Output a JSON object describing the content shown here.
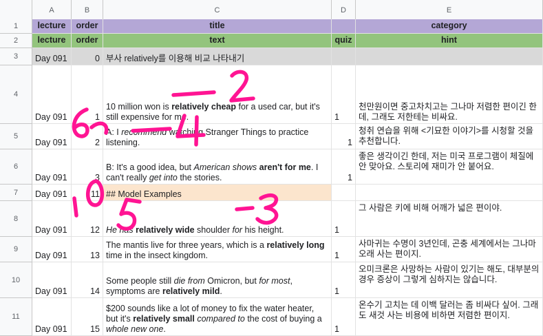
{
  "columns": [
    "A",
    "B",
    "C",
    "D",
    "E"
  ],
  "header_row_1": {
    "num": "1",
    "lecture": "lecture",
    "order": "order",
    "title": "title",
    "category": "category"
  },
  "header_row_2": {
    "num": "2",
    "lecture": "lecture",
    "order": "order",
    "text": "text",
    "quiz": "quiz",
    "hint": "hint"
  },
  "rows": [
    {
      "num": "3",
      "lecture": "Day 091",
      "order": "0",
      "text_html": "부사 relatively를 이용해 비교 나타내기",
      "quiz": "",
      "hint": ""
    },
    {
      "num": "4",
      "lecture": "Day 091",
      "order": "1",
      "text_html": "10 million won is <b>relatively cheap</b> for a used car, but it's still expensive for me.",
      "quiz": "1",
      "hint": "천만원이면 중고차치고는 그나마 저렴한 편이긴 한데, 그래도 저한테는 비싸요."
    },
    {
      "num": "5",
      "lecture": "Day 091",
      "order": "2",
      "text_html": "A: I <i>recommend</i> watching Stranger Things to practice listening.",
      "quiz": "1",
      "hint": "청취 연습을 위해 <기묘한 이야기>를 시청할 것을 추천합니다."
    },
    {
      "num": "6",
      "lecture": "Day 091",
      "order": "3",
      "text_html": "B: It's a good idea, but <i>American shows</i> <b>aren't for me</b>. I can't really <i>get into</i> the stories.",
      "quiz": "1",
      "hint": "좋은 생각이긴 한데, 저는 미국 프로그램이 체질에 안 맞아요. 스토리에 재미가 안 붙어요."
    },
    {
      "num": "7",
      "lecture": "Day 091",
      "order": "11",
      "text_html": "## Model Examples",
      "quiz": "",
      "hint": ""
    },
    {
      "num": "8",
      "lecture": "Day 091",
      "order": "12",
      "text_html": "<i>He has</i> <b>relatively wide</b> shoulder <i>for</i> his height.",
      "quiz": "1",
      "hint": "그 사람은 키에 비해 어깨가 넓은 편이야."
    },
    {
      "num": "9",
      "lecture": "Day 091",
      "order": "13",
      "text_html": "The mantis live for three years, which is a <b>relatively long</b> time in the insect kingdom.",
      "quiz": "1",
      "hint": "사마귀는 수명이 3년인데, 곤충 세계에서는 그나마 오래 사는 편이지."
    },
    {
      "num": "10",
      "lecture": "Day 091",
      "order": "14",
      "text_html": "Some people still <i>die from</i> Omicron, but <i>for most</i>, symptoms are <b>relatively mild</b>.",
      "quiz": "1",
      "hint": "오미크론은 사망하는 사람이 있기는 해도, 대부분의 경우 증상이 그렇게 심하지는 않습니다."
    },
    {
      "num": "11",
      "lecture": "Day 091",
      "order": "15",
      "text_html": "$200 sounds like a lot of money to fix the water heater, but it's <b>relatively small</b> <i>compared to</i> the cost of buying a <i>whole new one</i>.",
      "quiz": "1",
      "hint": "온수기 고치는 데 이백 달러는 좀 비싸다 싶어. 그래도 새것 사는 비용에 비하면 저렴한 편이지."
    }
  ],
  "colors": {
    "header_purple": "#b4a7d6",
    "header_green": "#93c47d",
    "section_gray": "#d9d9d9",
    "highlight_peach": "#fce5cd",
    "annotation_pink": "#ff1493"
  }
}
